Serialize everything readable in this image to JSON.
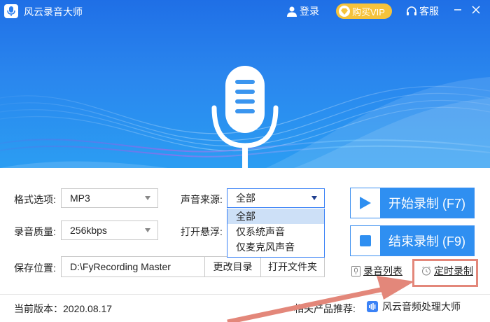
{
  "app": {
    "title": "风云录音大师"
  },
  "header": {
    "login_label": "登录",
    "vip_label": "购买VIP",
    "service_label": "客服"
  },
  "form": {
    "format_label": "格式选项:",
    "format_value": "MP3",
    "quality_label": "录音质量:",
    "quality_value": "256kbps",
    "save_label": "保存位置:",
    "save_path": "D:\\FyRecording Master",
    "change_dir_label": "更改目录",
    "open_folder_label": "打开文件夹",
    "source_label": "声音来源:",
    "source_value": "全部",
    "source_options": [
      "全部",
      "仅系统声音",
      "仅麦克风声音"
    ],
    "float_label": "打开悬浮:"
  },
  "actions": {
    "start_label": "开始录制 (F7)",
    "stop_label": "结束录制 (F9)",
    "list_label": "录音列表",
    "timer_label": "定时录制"
  },
  "footer": {
    "version_text": "当前版本：2020.08.17",
    "related_label": "相关产品推荐:",
    "product_label": "风云音频处理大师"
  },
  "colors": {
    "accent": "#2f8ff1",
    "vip": "#f5c33b",
    "highlight": "#e3877a"
  }
}
